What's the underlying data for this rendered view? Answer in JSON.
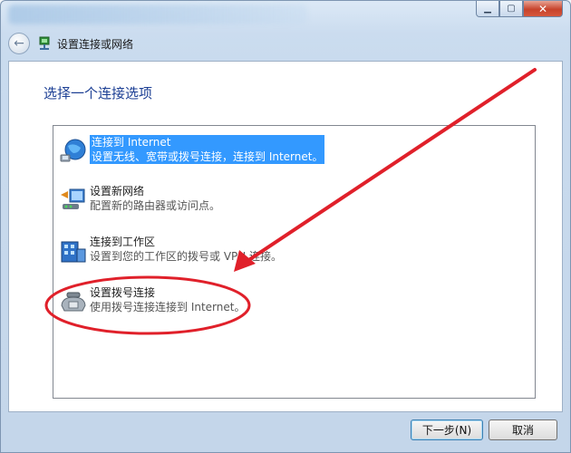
{
  "window": {
    "minimize_icon": "minimize-icon",
    "maximize_icon": "maximize-icon",
    "close_icon": "close-icon"
  },
  "nav": {
    "title": "设置连接或网络"
  },
  "main": {
    "heading": "选择一个连接选项",
    "options": [
      {
        "title": "连接到 Internet",
        "desc": "设置无线、宽带或拨号连接，连接到 Internet。",
        "icon": "globe-network-icon",
        "selected": true
      },
      {
        "title": "设置新网络",
        "desc": "配置新的路由器或访问点。",
        "icon": "router-icon",
        "selected": false
      },
      {
        "title": "连接到工作区",
        "desc": "设置到您的工作区的拨号或 VPN 连接。",
        "icon": "workplace-building-icon",
        "selected": false
      },
      {
        "title": "设置拨号连接",
        "desc": "使用拨号连接连接到 Internet。",
        "icon": "dialup-phone-icon",
        "selected": false
      }
    ]
  },
  "footer": {
    "next_label": "下一步(N)",
    "cancel_label": "取消"
  },
  "colors": {
    "selection": "#3399ff",
    "heading": "#1c3f94",
    "annotation": "#e0202a"
  }
}
